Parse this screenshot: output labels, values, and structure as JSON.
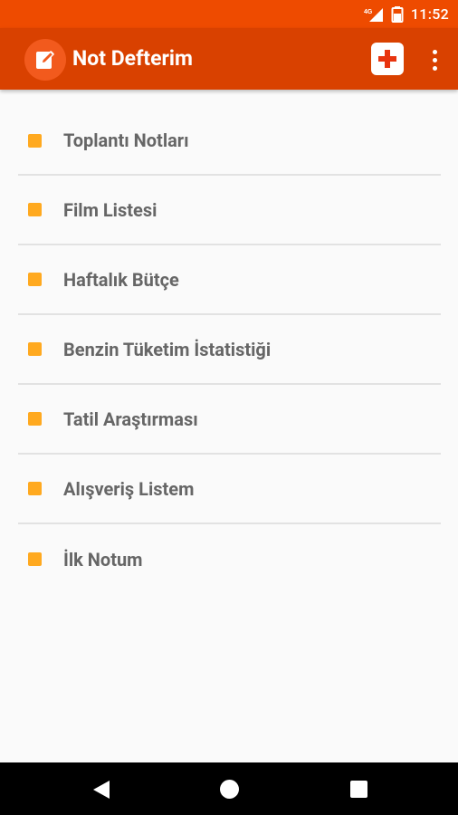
{
  "status_bar": {
    "network": "4G",
    "time": "11:52"
  },
  "app_bar": {
    "title": "Not Defterim"
  },
  "notes": [
    {
      "label": "Toplantı Notları"
    },
    {
      "label": "Film Listesi"
    },
    {
      "label": "Haftalık Bütçe"
    },
    {
      "label": "Benzin Tüketim İstatistiği"
    },
    {
      "label": "Tatil Araştırması"
    },
    {
      "label": "Alışveriş Listem"
    },
    {
      "label": "İlk Notum"
    }
  ],
  "colors": {
    "status_bar": "#ee4b00",
    "app_bar": "#d94100",
    "bullet": "#ffa91f",
    "text": "#666666",
    "background": "#fafafa"
  },
  "icons": {
    "app_logo": "edit-note-icon",
    "add": "plus-icon",
    "more": "more-vert-icon",
    "nav_back": "back-triangle-icon",
    "nav_home": "home-circle-icon",
    "nav_recent": "recent-square-icon"
  }
}
